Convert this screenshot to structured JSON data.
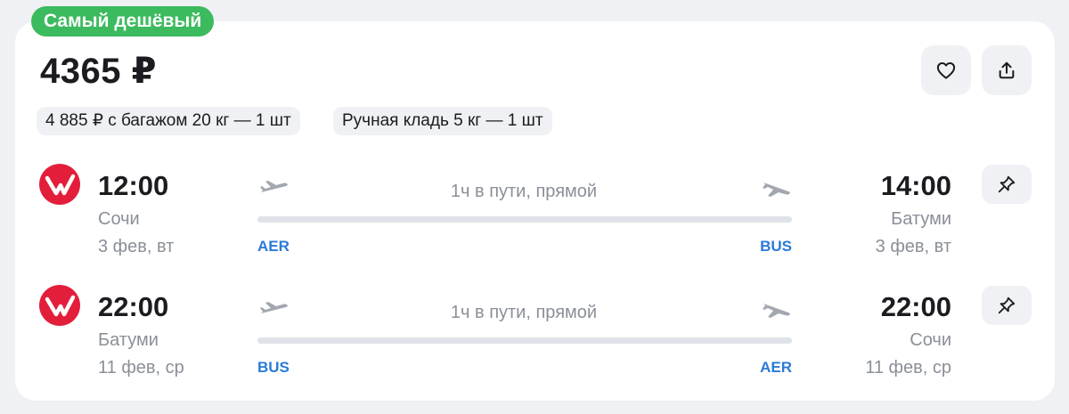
{
  "badge": "Самый дешёвый",
  "price": "4365 ₽",
  "actions": {
    "favorite_icon": "heart-icon",
    "share_icon": "share-icon"
  },
  "chips": [
    "4 885 ₽ с багажом 20 кг — 1 шт",
    "Ручная кладь 5 кг — 1 шт"
  ],
  "flights": [
    {
      "depart_time": "12:00",
      "depart_city": "Сочи",
      "depart_date": "3 фев, вт",
      "depart_code": "AER",
      "duration": "1ч в пути, прямой",
      "arrive_time": "14:00",
      "arrive_city": "Батуми",
      "arrive_date": "3 фев, вт",
      "arrive_code": "BUS"
    },
    {
      "depart_time": "22:00",
      "depart_city": "Батуми",
      "depart_date": "11 фев, ср",
      "depart_code": "BUS",
      "duration": "1ч в пути, прямой",
      "arrive_time": "22:00",
      "arrive_city": "Сочи",
      "arrive_date": "11 фев, ср",
      "arrive_code": "AER"
    }
  ],
  "colors": {
    "badge": "#3cba5e",
    "airline_logo": "#e31e3a",
    "airport_code": "#2b7ad7",
    "muted_text": "#8a8f98"
  }
}
